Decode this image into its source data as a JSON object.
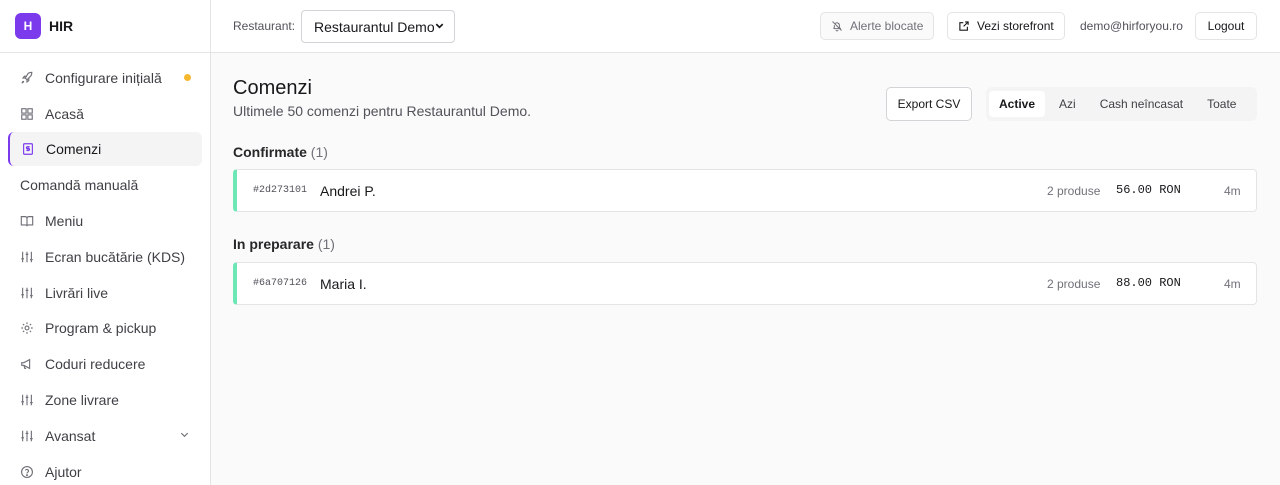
{
  "brand": {
    "logo_letter": "H",
    "name": "HIR"
  },
  "sidebar": {
    "items": [
      {
        "label": "Configurare inițială",
        "icon": "rocket-icon"
      },
      {
        "label": "Acasă",
        "icon": "grid-icon"
      },
      {
        "label": "Comenzi",
        "icon": "receipt-icon"
      },
      {
        "label": "Comandă manuală",
        "icon": ""
      },
      {
        "label": "Meniu",
        "icon": "book-icon"
      },
      {
        "label": "Ecran bucătărie (KDS)",
        "icon": "sliders-icon"
      },
      {
        "label": "Livrări live",
        "icon": "sliders-icon"
      },
      {
        "label": "Program & pickup",
        "icon": "gear-icon"
      },
      {
        "label": "Coduri reducere",
        "icon": "megaphone-icon"
      },
      {
        "label": "Zone livrare",
        "icon": "sliders-icon"
      },
      {
        "label": "Avansat",
        "icon": "sliders-icon"
      },
      {
        "label": "Ajutor",
        "icon": "help-icon"
      }
    ]
  },
  "topbar": {
    "restaurant_label": "Restaurant:",
    "restaurant_value": "Restaurantul Demo",
    "alerts_label": "Alerte blocate",
    "storefront_label": "Vezi storefront",
    "email": "demo@hirforyou.ro",
    "logout_label": "Logout"
  },
  "main": {
    "title": "Comenzi",
    "subtitle": "Ultimele 50 comenzi pentru Restaurantul Demo.",
    "export_label": "Export CSV",
    "tabs": [
      {
        "label": "Active"
      },
      {
        "label": "Azi"
      },
      {
        "label": "Cash neîncasat"
      },
      {
        "label": "Toate"
      }
    ],
    "sections": [
      {
        "title": "Confirmate",
        "count": "(1)",
        "order": {
          "id": "#2d273101",
          "name": "Andrei P.",
          "items": "2 produse",
          "total": "56.00 RON",
          "age": "4m"
        }
      },
      {
        "title": "In preparare",
        "count": "(1)",
        "order": {
          "id": "#6a707126",
          "name": "Maria I.",
          "items": "2 produse",
          "total": "88.00 RON",
          "age": "4m"
        }
      }
    ]
  },
  "colors": {
    "accent": "#7c3aed",
    "status_bar": "#6ee7b7",
    "setup_dot": "#f5b82e"
  }
}
